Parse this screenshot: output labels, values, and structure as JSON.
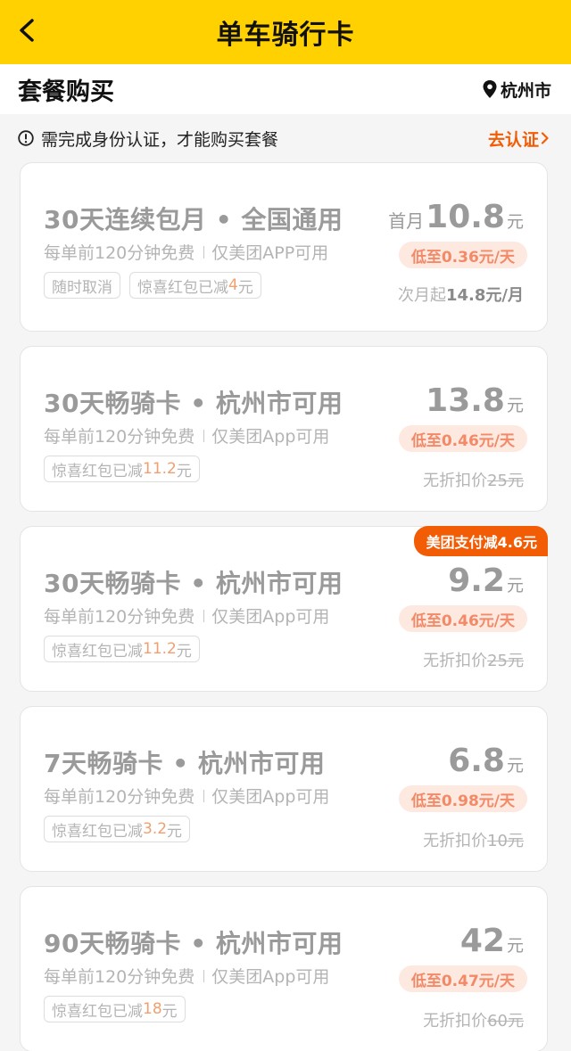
{
  "header": {
    "title": "单车骑行卡"
  },
  "subbar": {
    "section_title": "套餐购买",
    "city": "杭州市"
  },
  "notice": {
    "text": "需完成身份认证，才能购买套餐",
    "action": "去认证"
  },
  "cards": [
    {
      "title": "30天连续包月 • 全国通用",
      "desc_a": "每单前120分钟免费",
      "desc_b": "仅美团APP可用",
      "tag1": "随时取消",
      "tag2_text": "惊喜红包已减",
      "tag2_value": "4",
      "tag2_unit": "元",
      "price_prefix": "首月",
      "price": "10.8",
      "unit": "元",
      "daily": "低至0.36元/天",
      "next_prefix": "次月起",
      "next_price": "14.8元/月"
    },
    {
      "title": "30天畅骑卡 • 杭州市可用",
      "desc_a": "每单前120分钟免费",
      "desc_b": "仅美团App可用",
      "tag_text": "惊喜红包已减",
      "tag_value": "11.2",
      "tag_unit": "元",
      "price": "13.8",
      "unit": "元",
      "daily": "低至0.46元/天",
      "orig_label": "无折扣价",
      "orig_price": "25元"
    },
    {
      "badge": "美团支付减4.6元",
      "title": "30天畅骑卡 • 杭州市可用",
      "desc_a": "每单前120分钟免费",
      "desc_b": "仅美团App可用",
      "tag_text": "惊喜红包已减",
      "tag_value": "11.2",
      "tag_unit": "元",
      "price": "9.2",
      "unit": "元",
      "daily": "低至0.46元/天",
      "orig_label": "无折扣价",
      "orig_price": "25元"
    },
    {
      "title": "7天畅骑卡 • 杭州市可用",
      "desc_a": "每单前120分钟免费",
      "desc_b": "仅美团App可用",
      "tag_text": "惊喜红包已减",
      "tag_value": "3.2",
      "tag_unit": "元",
      "price": "6.8",
      "unit": "元",
      "daily": "低至0.98元/天",
      "orig_label": "无折扣价",
      "orig_price": "10元"
    },
    {
      "title": "90天畅骑卡 • 杭州市可用",
      "desc_a": "每单前120分钟免费",
      "desc_b": "仅美团App可用",
      "tag_text": "惊喜红包已减",
      "tag_value": "18",
      "tag_unit": "元",
      "price": "42",
      "unit": "元",
      "daily": "低至0.47元/天",
      "orig_label": "无折扣价",
      "orig_price": "60元"
    }
  ],
  "colors": {
    "header": "#ffd100",
    "accent": "#f25c05",
    "daily_bg": "#fde9e0",
    "daily_text": "#f28a68"
  }
}
